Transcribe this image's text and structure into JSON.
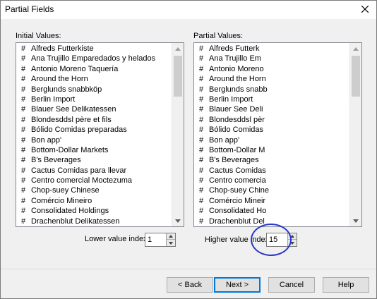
{
  "window": {
    "title": "Partial Fields"
  },
  "initial": {
    "label": "Initial Values:",
    "items": [
      "Alfreds Futterkiste",
      "Ana Trujillo Emparedados y helados",
      "Antonio Moreno Taquería",
      "Around the Horn",
      "Berglunds snabbköp",
      "Berlin Import",
      "Blauer See Delikatessen",
      "Blondesddsl père et fils",
      "Bólido Comidas preparadas",
      "Bon app'",
      "Bottom-Dollar Markets",
      "B's Beverages",
      "Cactus Comidas para llevar",
      "Centro comercial Moctezuma",
      "Chop-suey Chinese",
      "Comércio Mineiro",
      "Consolidated Holdings",
      "Drachenblut Delikatessen"
    ]
  },
  "partial": {
    "label": "Partial Values:",
    "items": [
      "Alfreds Futterk",
      "Ana Trujillo Em",
      "Antonio Moreno",
      "Around the Horn",
      "Berglunds snabb",
      "Berlin Import",
      "Blauer See Deli",
      "Blondesddsl pèr",
      "Bólido Comidas",
      "Bon app'",
      "Bottom-Dollar M",
      "B's Beverages",
      "Cactus Comidas",
      "Centro comercia",
      "Chop-suey Chine",
      "Comércio Mineir",
      "Consolidated Ho",
      "Drachenblut Del"
    ]
  },
  "lower": {
    "label": "Lower value index :",
    "value": "1"
  },
  "higher": {
    "label": "Higher value index :",
    "value": "15"
  },
  "buttons": {
    "back": "< Back",
    "next": "Next >",
    "cancel": "Cancel",
    "help": "Help"
  },
  "icons": {
    "list_item": "hash-icon",
    "close": "close-icon"
  },
  "colors": {
    "highlight_circle": "#2936c9",
    "default_button_border": "#0078d7"
  }
}
